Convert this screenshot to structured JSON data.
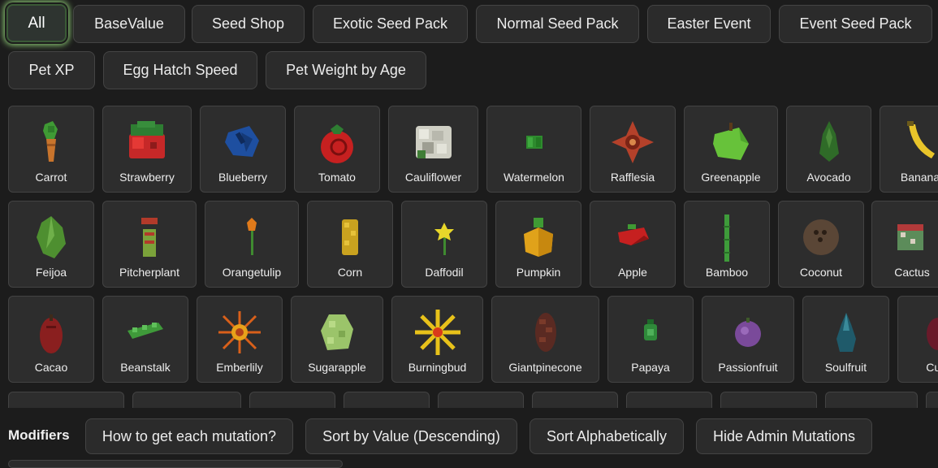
{
  "filters": [
    {
      "label": "All",
      "active": true
    },
    {
      "label": "BaseValue"
    },
    {
      "label": "Seed Shop"
    },
    {
      "label": "Exotic Seed Pack"
    },
    {
      "label": "Normal Seed Pack"
    },
    {
      "label": "Easter Event"
    },
    {
      "label": "Event Seed Pack"
    },
    {
      "label": "Pet XP"
    },
    {
      "label": "Egg Hatch Speed"
    },
    {
      "label": "Pet Weight by Age"
    }
  ],
  "items": [
    {
      "name": "Carrot",
      "icon": "carrot-icon"
    },
    {
      "name": "Strawberry",
      "icon": "strawberry-icon"
    },
    {
      "name": "Blueberry",
      "icon": "blueberry-icon"
    },
    {
      "name": "Tomato",
      "icon": "tomato-icon"
    },
    {
      "name": "Cauliflower",
      "icon": "cauliflower-icon"
    },
    {
      "name": "Watermelon",
      "icon": "watermelon-icon"
    },
    {
      "name": "Rafflesia",
      "icon": "rafflesia-icon"
    },
    {
      "name": "Greenapple",
      "icon": "greenapple-icon"
    },
    {
      "name": "Avocado",
      "icon": "avocado-icon"
    },
    {
      "name": "Banana",
      "icon": "banana-icon"
    },
    {
      "name": "Feijoa",
      "icon": "feijoa-icon"
    },
    {
      "name": "Pitcherplant",
      "icon": "pitcherplant-icon"
    },
    {
      "name": "Orangetulip",
      "icon": "orangetulip-icon"
    },
    {
      "name": "Corn",
      "icon": "corn-icon"
    },
    {
      "name": "Daffodil",
      "icon": "daffodil-icon"
    },
    {
      "name": "Pumpkin",
      "icon": "pumpkin-icon"
    },
    {
      "name": "Apple",
      "icon": "apple-icon"
    },
    {
      "name": "Bamboo",
      "icon": "bamboo-icon"
    },
    {
      "name": "Coconut",
      "icon": "coconut-icon"
    },
    {
      "name": "Cactus",
      "icon": "cactus-icon"
    },
    {
      "name": "Cacao",
      "icon": "cacao-icon"
    },
    {
      "name": "Beanstalk",
      "icon": "beanstalk-icon"
    },
    {
      "name": "Emberlily",
      "icon": "emberlily-icon"
    },
    {
      "name": "Sugarapple",
      "icon": "sugarapple-icon"
    },
    {
      "name": "Burningbud",
      "icon": "burningbud-icon"
    },
    {
      "name": "Giantpinecone",
      "icon": "giantpinecone-icon"
    },
    {
      "name": "Papaya",
      "icon": "papaya-icon"
    },
    {
      "name": "Passionfruit",
      "icon": "passionfruit-icon"
    },
    {
      "name": "Soulfruit",
      "icon": "soulfruit-icon"
    },
    {
      "name": "Curs",
      "icon": "cursed-fruit-icon"
    }
  ],
  "modifiers": {
    "label": "Modifiers",
    "buttons": [
      {
        "label": "How to get each mutation?"
      },
      {
        "label": "Sort by Value (Descending)"
      },
      {
        "label": "Sort Alphabetically"
      },
      {
        "label": "Hide Admin Mutations"
      }
    ]
  },
  "colors": {
    "accent_glow": "#9be07f",
    "background": "#1c1c1c",
    "card": "#2d2d2d"
  }
}
